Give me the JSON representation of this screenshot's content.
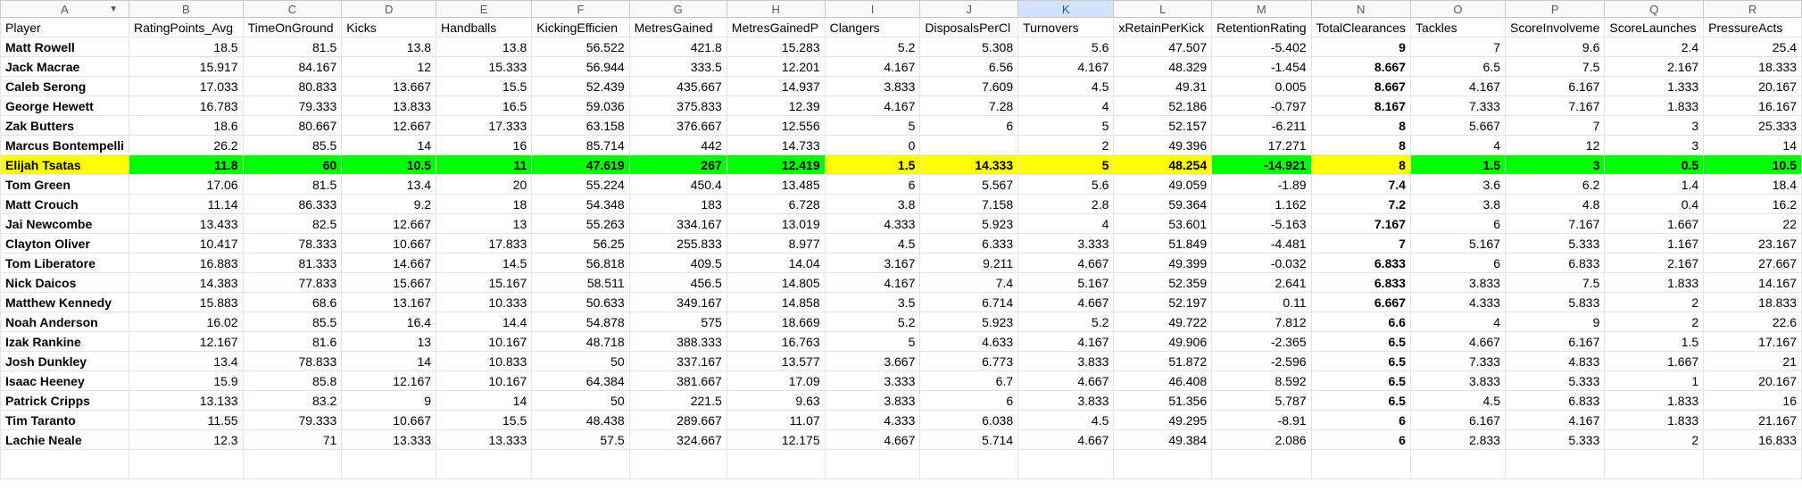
{
  "columns": [
    "A",
    "B",
    "C",
    "D",
    "E",
    "F",
    "G",
    "H",
    "I",
    "J",
    "K",
    "L",
    "M",
    "N",
    "O",
    "P",
    "Q",
    "R"
  ],
  "selected_column": "K",
  "headers": [
    "Player",
    "RatingPoints_Avg",
    "TimeOnGround",
    "Kicks",
    "Handballs",
    "KickingEfficien",
    "MetresGained",
    "MetresGainedP",
    "Clangers",
    "DisposalsPerCl",
    "Turnovers",
    "xRetainPerKick",
    "RetentionRating",
    "TotalClearances",
    "Tackles",
    "ScoreInvolveme",
    "ScoreLaunches",
    "PressureActs"
  ],
  "rows": [
    [
      "Matt Rowell",
      "18.5",
      "81.5",
      "13.8",
      "13.8",
      "56.522",
      "421.8",
      "15.283",
      "5.2",
      "5.308",
      "5.6",
      "47.507",
      "-5.402",
      "9",
      "7",
      "9.6",
      "2.4",
      "25.4"
    ],
    [
      "Jack Macrae",
      "15.917",
      "84.167",
      "12",
      "15.333",
      "56.944",
      "333.5",
      "12.201",
      "4.167",
      "6.56",
      "4.167",
      "48.329",
      "-1.454",
      "8.667",
      "6.5",
      "7.5",
      "2.167",
      "18.333"
    ],
    [
      "Caleb Serong",
      "17.033",
      "80.833",
      "13.667",
      "15.5",
      "52.439",
      "435.667",
      "14.937",
      "3.833",
      "7.609",
      "4.5",
      "49.31",
      "0.005",
      "8.667",
      "4.167",
      "6.167",
      "1.333",
      "20.167"
    ],
    [
      "George Hewett",
      "16.783",
      "79.333",
      "13.833",
      "16.5",
      "59.036",
      "375.833",
      "12.39",
      "4.167",
      "7.28",
      "4",
      "52.186",
      "-0.797",
      "8.167",
      "7.333",
      "7.167",
      "1.833",
      "16.167"
    ],
    [
      "Zak Butters",
      "18.6",
      "80.667",
      "12.667",
      "17.333",
      "63.158",
      "376.667",
      "12.556",
      "5",
      "6",
      "5",
      "52.157",
      "-6.211",
      "8",
      "5.667",
      "7",
      "3",
      "25.333"
    ],
    [
      "Marcus Bontempelli",
      "26.2",
      "85.5",
      "14",
      "16",
      "85.714",
      "442",
      "14.733",
      "0",
      "",
      "2",
      "49.396",
      "17.271",
      "8",
      "4",
      "12",
      "3",
      "14"
    ],
    [
      "Elijah Tsatas",
      "11.8",
      "60",
      "10.5",
      "11",
      "47.619",
      "267",
      "12.419",
      "1.5",
      "14.333",
      "5",
      "48.254",
      "-14.921",
      "8",
      "1.5",
      "3",
      "0.5",
      "10.5"
    ],
    [
      "Tom Green",
      "17.06",
      "81.5",
      "13.4",
      "20",
      "55.224",
      "450.4",
      "13.485",
      "6",
      "5.567",
      "5.6",
      "49.059",
      "-1.89",
      "7.4",
      "3.6",
      "6.2",
      "1.4",
      "18.4"
    ],
    [
      "Matt Crouch",
      "11.14",
      "86.333",
      "9.2",
      "18",
      "54.348",
      "183",
      "6.728",
      "3.8",
      "7.158",
      "2.8",
      "59.364",
      "1.162",
      "7.2",
      "3.8",
      "4.8",
      "0.4",
      "16.2"
    ],
    [
      "Jai Newcombe",
      "13.433",
      "82.5",
      "12.667",
      "13",
      "55.263",
      "334.167",
      "13.019",
      "4.333",
      "5.923",
      "4",
      "53.601",
      "-5.163",
      "7.167",
      "6",
      "7.167",
      "1.667",
      "22"
    ],
    [
      "Clayton Oliver",
      "10.417",
      "78.333",
      "10.667",
      "17.833",
      "56.25",
      "255.833",
      "8.977",
      "4.5",
      "6.333",
      "3.333",
      "51.849",
      "-4.481",
      "7",
      "5.167",
      "5.333",
      "1.167",
      "23.167"
    ],
    [
      "Tom Liberatore",
      "16.883",
      "81.333",
      "14.667",
      "14.5",
      "56.818",
      "409.5",
      "14.04",
      "3.167",
      "9.211",
      "4.667",
      "49.399",
      "-0.032",
      "6.833",
      "6",
      "6.833",
      "2.167",
      "27.667"
    ],
    [
      "Nick Daicos",
      "14.383",
      "77.833",
      "15.667",
      "15.167",
      "58.511",
      "456.5",
      "14.805",
      "4.167",
      "7.4",
      "5.167",
      "52.359",
      "2.641",
      "6.833",
      "3.833",
      "7.5",
      "1.833",
      "14.167"
    ],
    [
      "Matthew Kennedy",
      "15.883",
      "68.6",
      "13.167",
      "10.333",
      "50.633",
      "349.167",
      "14.858",
      "3.5",
      "6.714",
      "4.667",
      "52.197",
      "0.11",
      "6.667",
      "4.333",
      "5.833",
      "2",
      "18.833"
    ],
    [
      "Noah Anderson",
      "16.02",
      "85.5",
      "16.4",
      "14.4",
      "54.878",
      "575",
      "18.669",
      "5.2",
      "5.923",
      "5.2",
      "49.722",
      "7.812",
      "6.6",
      "4",
      "9",
      "2",
      "22.6"
    ],
    [
      "Izak Rankine",
      "12.167",
      "81.6",
      "13",
      "10.167",
      "48.718",
      "388.333",
      "16.763",
      "5",
      "4.633",
      "4.167",
      "49.906",
      "-2.365",
      "6.5",
      "4.667",
      "6.167",
      "1.5",
      "17.167"
    ],
    [
      "Josh Dunkley",
      "13.4",
      "78.833",
      "14",
      "10.833",
      "50",
      "337.167",
      "13.577",
      "3.667",
      "6.773",
      "3.833",
      "51.872",
      "-2.596",
      "6.5",
      "7.333",
      "4.833",
      "1.667",
      "21"
    ],
    [
      "Isaac Heeney",
      "15.9",
      "85.8",
      "12.167",
      "10.167",
      "64.384",
      "381.667",
      "17.09",
      "3.333",
      "6.7",
      "4.667",
      "46.408",
      "8.592",
      "6.5",
      "3.833",
      "5.333",
      "1",
      "20.167"
    ],
    [
      "Patrick Cripps",
      "13.133",
      "83.2",
      "9",
      "14",
      "50",
      "221.5",
      "9.63",
      "3.833",
      "6",
      "3.833",
      "51.356",
      "5.787",
      "6.5",
      "4.5",
      "6.833",
      "1.833",
      "16"
    ],
    [
      "Tim Taranto",
      "11.55",
      "79.333",
      "10.667",
      "15.5",
      "48.438",
      "289.667",
      "11.07",
      "4.333",
      "6.038",
      "4.5",
      "49.295",
      "-8.91",
      "6",
      "6.167",
      "4.167",
      "1.833",
      "21.167"
    ],
    [
      "Lachie Neale",
      "12.3",
      "71",
      "13.333",
      "13.333",
      "57.5",
      "324.667",
      "12.175",
      "4.667",
      "5.714",
      "4.667",
      "49.384",
      "2.086",
      "6",
      "2.833",
      "5.333",
      "2",
      "16.833"
    ]
  ],
  "highlight_row": 6,
  "highlight": {
    "yellow": "#ffff00",
    "green": "#00ff00"
  }
}
